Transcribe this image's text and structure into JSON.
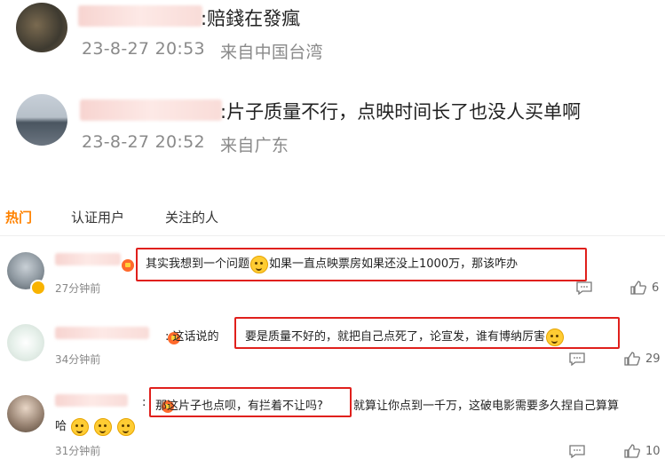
{
  "top_comments": [
    {
      "text": ":赔錢在發瘋",
      "time": "23-8-27 20:53",
      "location": "来自中国台湾"
    },
    {
      "text": ":片子质量不行，点映时间长了也没人买单啊",
      "time": "23-8-27 20:52",
      "location": "来自广东"
    }
  ],
  "tabs": [
    {
      "label": "热门",
      "active": true
    },
    {
      "label": "认证用户",
      "active": false
    },
    {
      "label": "关注的人",
      "active": false
    }
  ],
  "comments": [
    {
      "text": "其实我想到一个问题",
      "text_after_emoji": "如果一直点映票房如果还没上1000万，那该咋办",
      "time": "27分钟前",
      "likes": "6"
    },
    {
      "reply_prefix": ": 这话说的",
      "text": "要是质量不好的，就把自己点死了，论宣发，谁有博纳厉害",
      "time": "34分钟前",
      "likes": "29"
    },
    {
      "prefix": ":",
      "highlight": "那这片子也点呗，有拦着不让吗?",
      "text": "就算让你点到一千万，这破电影需要多久捏自己算算",
      "text_line2": "哈",
      "time": "31分钟前",
      "likes": "10"
    }
  ],
  "icons": [
    "comment-icon",
    "like-icon",
    "vip-badge-icon",
    "verified-icon",
    "emoji-icon"
  ],
  "colors": {
    "accent": "#ff8200",
    "highlight_box": "#e0201c",
    "meta": "#888888"
  }
}
